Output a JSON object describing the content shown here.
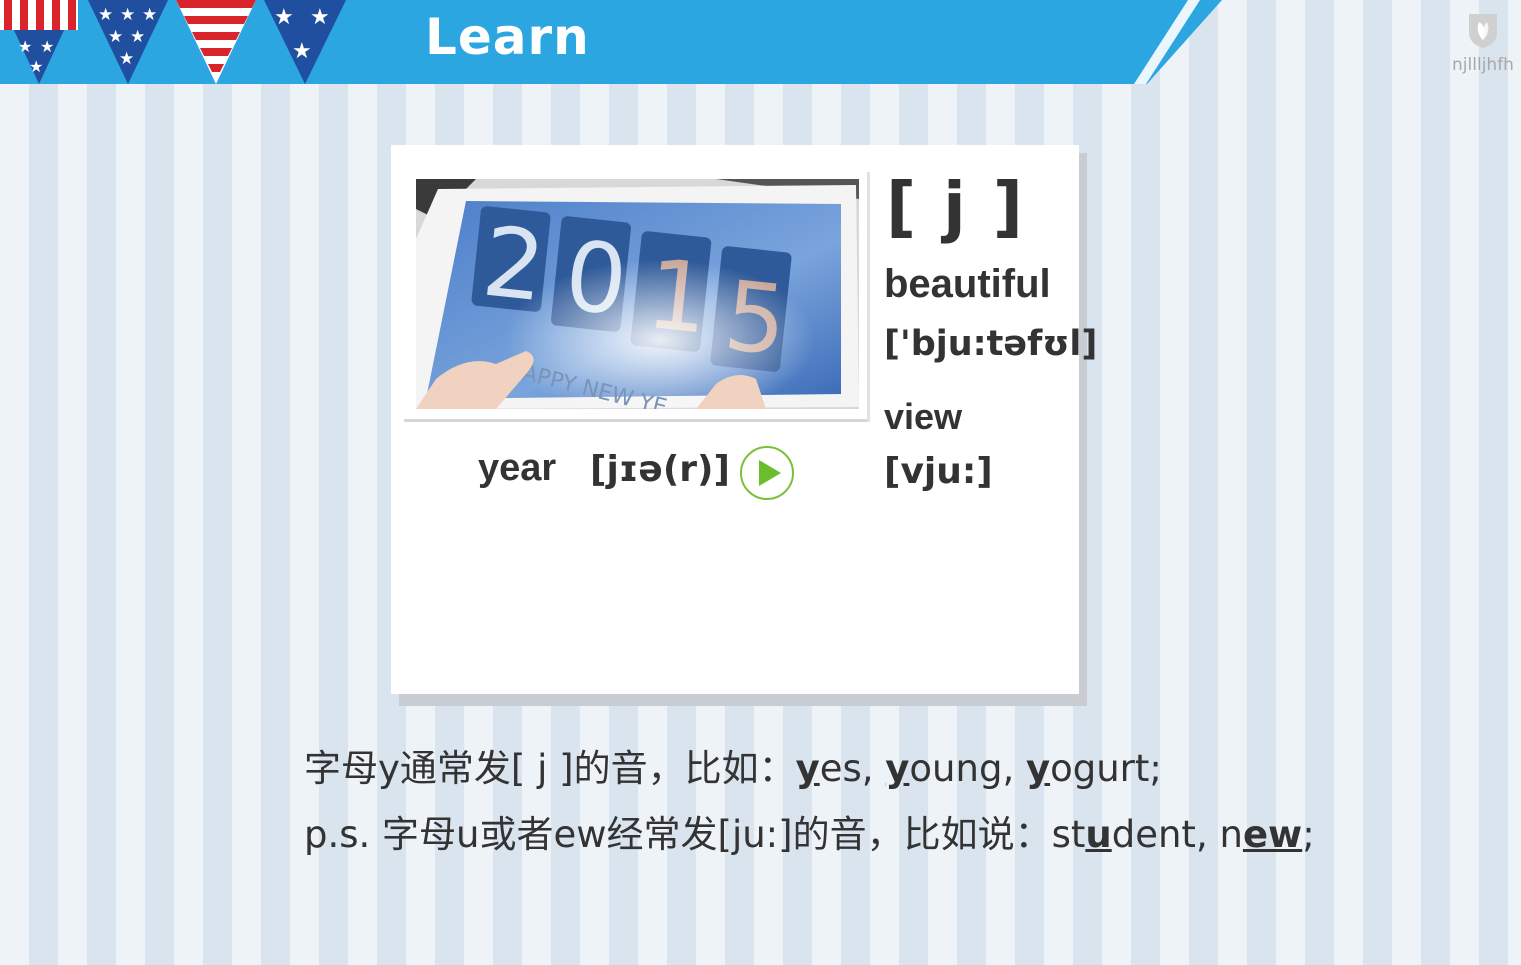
{
  "header": {
    "title": "Learn",
    "bar_color": "#29a7e0",
    "logo_label": "njllljhfh",
    "logo_icon": "leaf-shield-icon"
  },
  "card": {
    "photo_icon": "calendar-2015-flip-clock-image",
    "photo_numbers": [
      "2",
      "0",
      "1",
      "5"
    ],
    "photo_caption": "APPY NEW YE",
    "main_word": "year",
    "main_phonetic": "[jɪə(r)]",
    "play_icon": "play-icon",
    "sound_symbol": "[ j ]",
    "examples": [
      {
        "word": "beautiful",
        "phonetic": "['bju:təfʊl]"
      },
      {
        "word": "view",
        "phonetic": "[vju:]"
      }
    ]
  },
  "notes": {
    "line1": {
      "prefix": "字母y通常发[ j ]的音，比如：",
      "words": [
        {
          "hl": "y",
          "rest": "es"
        },
        {
          "hl": "y",
          "rest": "oung"
        },
        {
          "hl": "y",
          "rest": "ogurt"
        }
      ],
      "sep": ", ",
      "end": ";"
    },
    "line2": {
      "prefix": "p.s. 字母u或者ew经常发[ju:]的音，比如说：",
      "w1_pre": "st",
      "w1_hl": "u",
      "w1_post": "dent",
      "sep": ", ",
      "w2_pre": "n",
      "w2_hl": "ew",
      "end": ";"
    }
  }
}
